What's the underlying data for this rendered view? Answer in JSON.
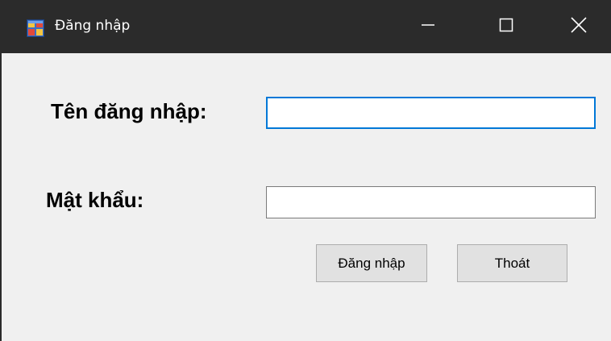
{
  "window": {
    "title": "Đăng nhập",
    "icon": "windows-form-icon",
    "controls": {
      "minimize_icon": "minimize-icon",
      "maximize_icon": "maximize-icon",
      "close_icon": "close-icon"
    }
  },
  "form": {
    "username_label": "Tên đăng nhập:",
    "username_value": "",
    "password_label": "Mật khẩu:",
    "password_value": "",
    "login_button": "Đăng nhập",
    "exit_button": "Thoát"
  },
  "colors": {
    "titlebar": "#2b2b2b",
    "client_background": "#f0f0f0",
    "focus_border": "#0078d7",
    "button_face": "#e1e1e1"
  }
}
